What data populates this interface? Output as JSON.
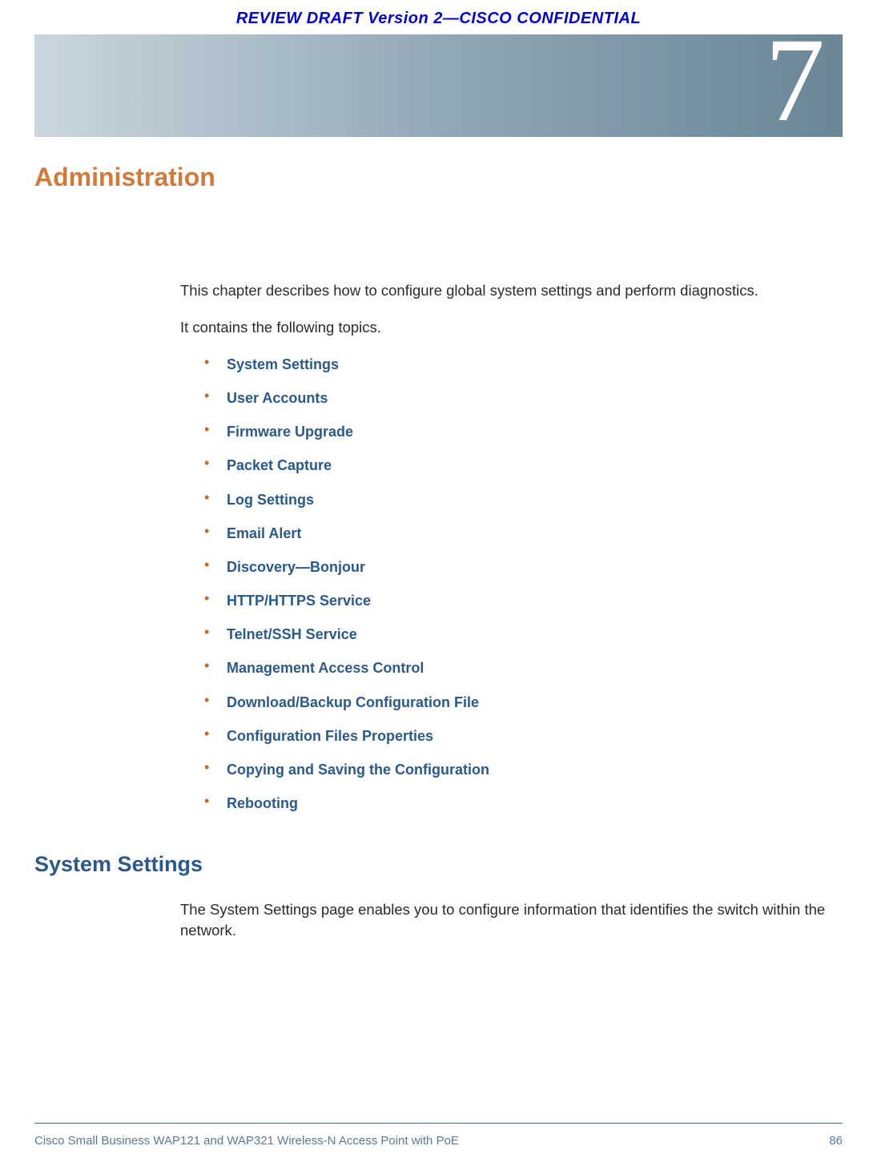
{
  "header": {
    "draft_notice": "REVIEW DRAFT  Version 2—CISCO CONFIDENTIAL"
  },
  "chapter": {
    "number": "7",
    "title": "Administration"
  },
  "intro": {
    "p1": "This chapter describes how to configure global system settings and perform diagnostics.",
    "p2": "It contains the following topics."
  },
  "topics": [
    "System Settings",
    "User Accounts",
    "Firmware Upgrade",
    "Packet Capture",
    "Log Settings",
    "Email Alert",
    "Discovery—Bonjour",
    "HTTP/HTTPS Service",
    "Telnet/SSH Service",
    "Management Access Control",
    "Download/Backup Configuration File",
    "Configuration Files Properties",
    "Copying and Saving the Configuration",
    "Rebooting"
  ],
  "section": {
    "heading": "System Settings",
    "body": "The System Settings page enables you to configure information that identifies the switch within the network."
  },
  "footer": {
    "product": "Cisco Small Business WAP121 and WAP321 Wireless-N Access Point with PoE",
    "page": "86"
  }
}
